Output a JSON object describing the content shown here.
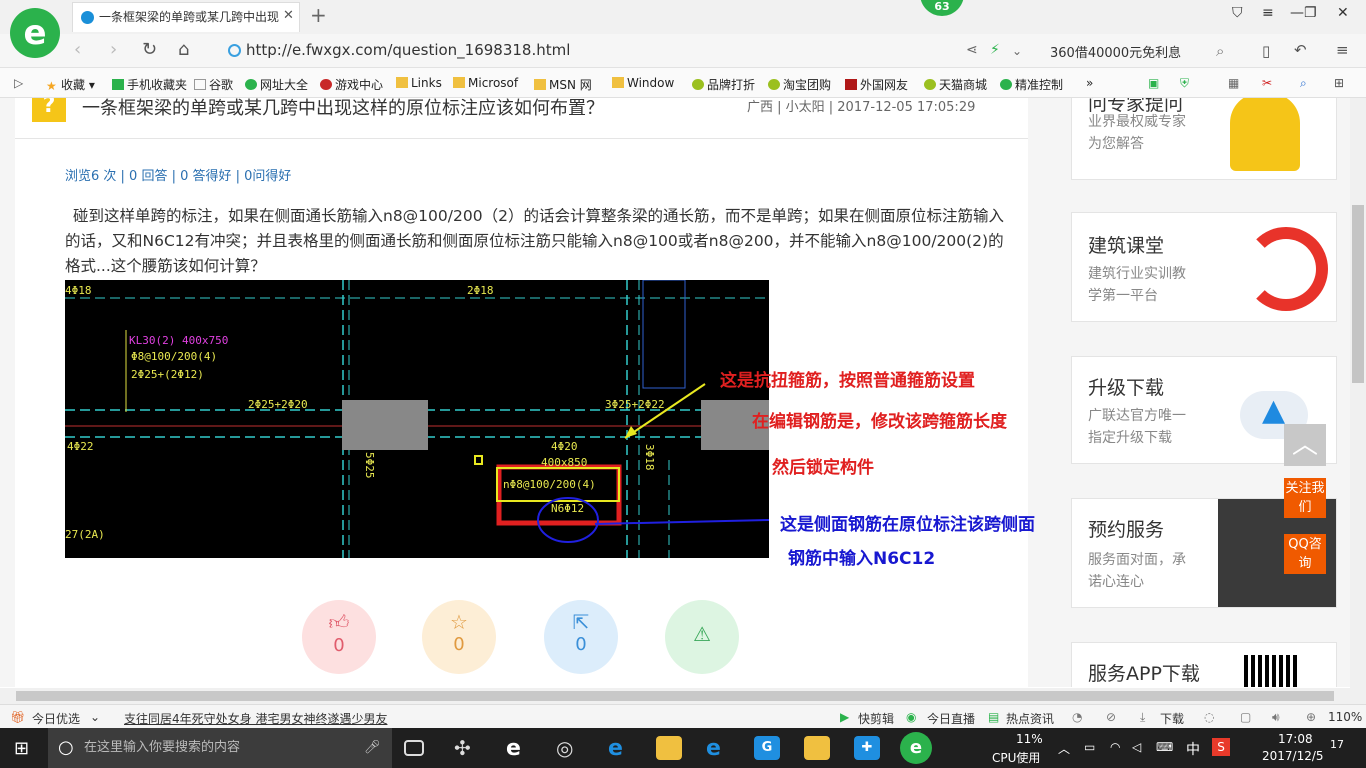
{
  "browser": {
    "tab_title": "一条框架梁的单跨或某几跨中出现",
    "badge_count": "63",
    "url": "http://e.fwxgx.com/question_1698318.html",
    "promo_text": "360借40000元免利息",
    "bookmarks": [
      "收藏",
      "手机收藏夹",
      "谷歌",
      "网址大全",
      "游戏中心",
      "Links",
      "Microsof",
      "MSN 网",
      "Window",
      "品牌打折",
      "淘宝团购",
      "外国网友",
      "天猫商城",
      "精准控制"
    ],
    "bookmarks_more": "»"
  },
  "question": {
    "title": "一条框架梁的单跨或某几跨中出现这样的原位标注应该如何布置？",
    "meta": "广西 | 小太阳 | 2017-12-05 17:05:29",
    "stats": "浏览6 次 | 0 回答 | 0 答得好 | 0问得好",
    "body": "碰到这样单跨的标注，如果在侧面通长筋输入n8@100/200（2）的话会计算整条梁的通长筋，而不是单跨；如果在侧面原位标注筋输入的话，又和N6C12有冲突；并且表格里的侧面通长筋和侧面原位标注筋只能输入n8@100或者n8@200，并不能输入n8@100/200(2)的格式...这个腰筋该如何计算？"
  },
  "cad": {
    "labels": {
      "l1": "4Φ18",
      "l2": "2Φ18",
      "l3": "KL30(2) 400x750",
      "l4": "Φ8@100/200(4)",
      "l5": "2Φ25+(2Φ12)",
      "l6": "2Φ25+2Φ20",
      "l7": "3Φ25+2Φ22",
      "l8": "4Φ22",
      "l9": "4Φ20",
      "l10": "400x850",
      "l11": "nΦ8@100/200(4)",
      "l12": "N6Φ12",
      "l13": "27(2A)",
      "l14": "5Φ25",
      "l15": "3Φ18"
    },
    "annotations": {
      "red1": "这是抗扭箍筋，按照普通箍筋设置",
      "red2": "在编辑钢筋是，修改该跨箍筋长度",
      "red3": "然后锁定构件",
      "blue1": "这是侧面钢筋在原位标注该跨侧面",
      "blue2": "钢筋中输入N6C12"
    }
  },
  "actions": {
    "like_count": "0",
    "star_count": "0",
    "share_count": "0"
  },
  "sidebar": {
    "card1": {
      "title": "问专家提问",
      "sub1": "业界最权威专家",
      "sub2": "为您解答"
    },
    "card2": {
      "title": "建筑课堂",
      "sub1": "建筑行业实训教",
      "sub2": "学第一平台"
    },
    "card3": {
      "title": "升级下载",
      "sub1": "广联达官方唯一",
      "sub2": "指定升级下载"
    },
    "card4": {
      "title": "预约服务",
      "sub1": "服务面对面，承",
      "sub2": "诺心连心"
    },
    "card5": {
      "title": "服务APP下载"
    },
    "float_follow": "关注我们",
    "float_qq": "QQ咨询"
  },
  "statusbar": {
    "left1": "今日优选",
    "news": "支往同居4年死守处女身 港宅男女神终遂遇少男友",
    "quickcut": "快剪辑",
    "live": "今日直播",
    "hot": "热点资讯",
    "download": "下载",
    "zoom": "110%"
  },
  "taskbar": {
    "search_placeholder": "在这里输入你要搜索的内容",
    "cpu": "11%",
    "cpu_label": "CPU使用",
    "ime": "中",
    "time": "17:08",
    "date": "2017/12/5",
    "notify_count": "17"
  }
}
